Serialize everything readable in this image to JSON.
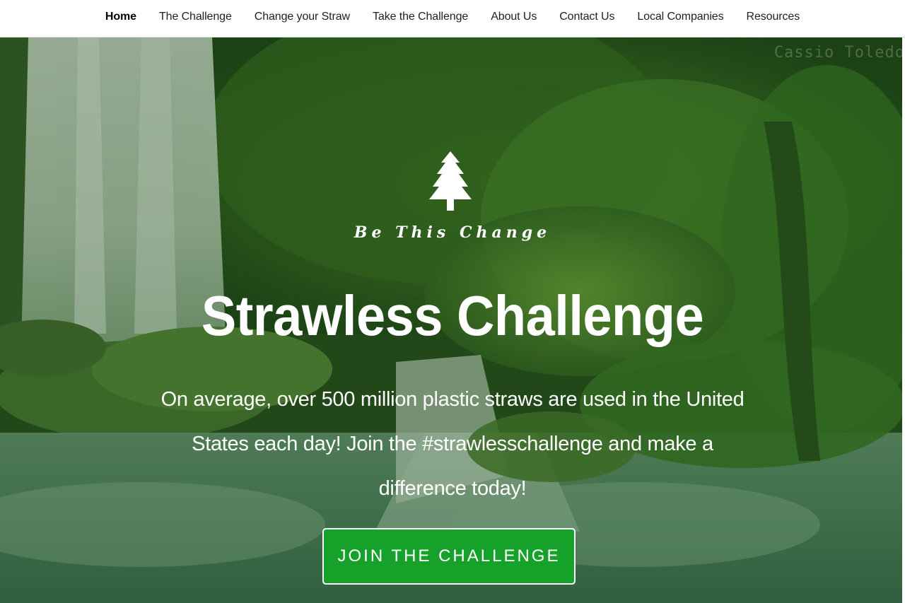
{
  "nav": {
    "items": [
      {
        "label": "Home",
        "active": true
      },
      {
        "label": "The Challenge"
      },
      {
        "label": "Change your Straw"
      },
      {
        "label": "Take the Challenge"
      },
      {
        "label": "About Us"
      },
      {
        "label": "Contact Us"
      },
      {
        "label": "Local Companies"
      },
      {
        "label": "Resources"
      }
    ]
  },
  "hero": {
    "photo_credit": "Cassio Toledo",
    "logo_icon": "pine-tree-icon",
    "tagline": "Be This Change",
    "title": "Strawless Challenge",
    "description": "On average, over 500 million plastic straws are used in the United States each day! Join the #strawlesschallenge and make a difference today!",
    "cta_label": "JOIN THE CHALLENGE"
  },
  "colors": {
    "cta_background": "#16a12b",
    "overlay": "#144614",
    "nav_background": "#ffffff"
  }
}
